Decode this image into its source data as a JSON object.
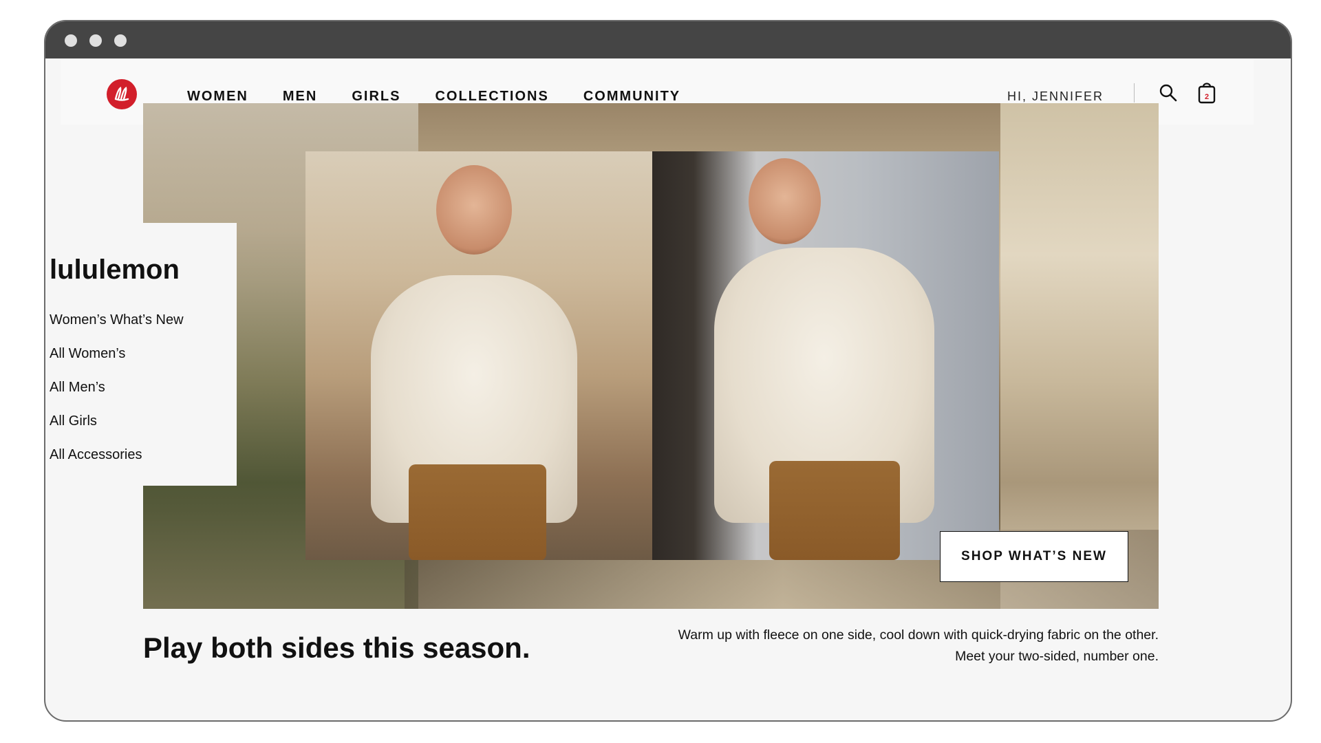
{
  "window": {
    "controls": [
      "dot",
      "dot",
      "dot"
    ]
  },
  "nav": {
    "links": [
      "WOMEN",
      "MEN",
      "GIRLS",
      "COLLECTIONS",
      "COMMUNITY"
    ],
    "greeting": "HI, JENNIFER",
    "bag_count": "2",
    "icons": {
      "logo": "lululemon-logo-icon",
      "search": "search-icon",
      "bag": "shopping-bag-icon"
    }
  },
  "side_menu": {
    "brand": "lululemon",
    "links": [
      "Women’s What’s New",
      "All Women’s",
      "All Men’s",
      "All Girls",
      "All Accessories"
    ]
  },
  "hero": {
    "cta_label": "SHOP WHAT’S NEW"
  },
  "footer_copy": {
    "headline": "Play both sides this season.",
    "description": "Warm up with fleece on one side, cool down with quick-drying fabric on the other. Meet your two-sided, number one."
  },
  "colors": {
    "brand_red": "#d21f2b",
    "text": "#111111",
    "page_bg": "#f6f6f6",
    "titlebar": "#454545"
  }
}
